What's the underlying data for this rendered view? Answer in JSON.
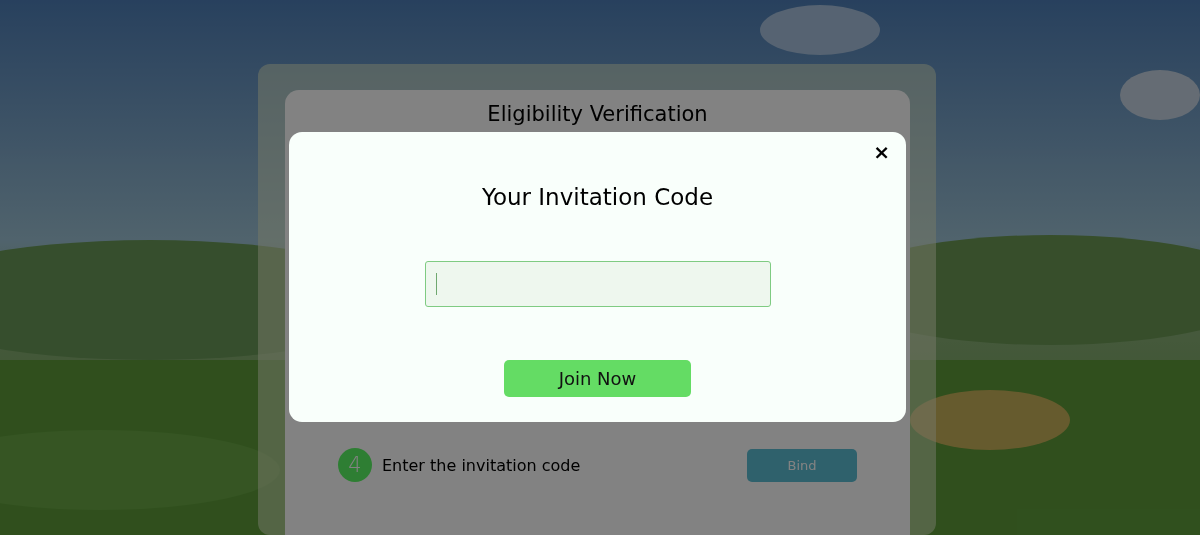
{
  "page": {
    "title": "Eligibility Verification",
    "steps": [
      {
        "number": "4",
        "label": "Enter the invitation code",
        "button": "Bind"
      }
    ]
  },
  "modal": {
    "title": "Your Invitation Code",
    "close": "×",
    "field": {
      "focused": true
    },
    "button": "Join Now"
  }
}
